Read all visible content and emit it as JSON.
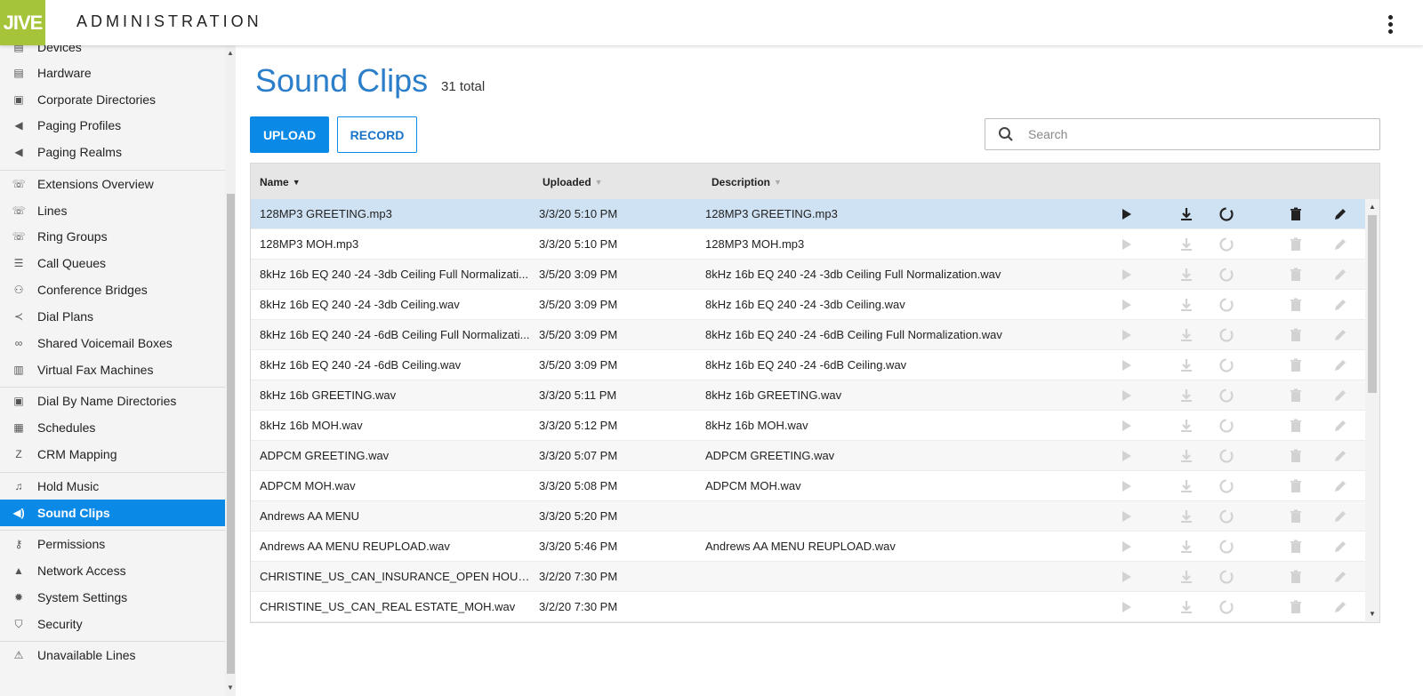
{
  "header": {
    "logo": "JIVE",
    "title": "ADMINISTRATION"
  },
  "sidebar": {
    "items": [
      {
        "label": "Devices",
        "icon": "list-icon"
      },
      {
        "label": "Hardware",
        "icon": "list-icon"
      },
      {
        "label": "Corporate Directories",
        "icon": "contact-book-icon"
      },
      {
        "label": "Paging Profiles",
        "icon": "megaphone-icon"
      },
      {
        "label": "Paging Realms",
        "icon": "megaphone-icon"
      },
      {
        "label": "Extensions Overview",
        "icon": "phone-icon"
      },
      {
        "label": "Lines",
        "icon": "phone-icon"
      },
      {
        "label": "Ring Groups",
        "icon": "ring-group-icon"
      },
      {
        "label": "Call Queues",
        "icon": "queue-icon"
      },
      {
        "label": "Conference Bridges",
        "icon": "conference-icon"
      },
      {
        "label": "Dial Plans",
        "icon": "dial-plan-icon"
      },
      {
        "label": "Shared Voicemail Boxes",
        "icon": "voicemail-icon"
      },
      {
        "label": "Virtual Fax Machines",
        "icon": "fax-icon"
      },
      {
        "label": "Dial By Name Directories",
        "icon": "contact-book-icon"
      },
      {
        "label": "Schedules",
        "icon": "calendar-icon"
      },
      {
        "label": "CRM Mapping",
        "icon": "crm-icon"
      },
      {
        "label": "Hold Music",
        "icon": "music-icon"
      },
      {
        "label": "Sound Clips",
        "icon": "speaker-icon"
      },
      {
        "label": "Permissions",
        "icon": "key-icon"
      },
      {
        "label": "Network Access",
        "icon": "lock-icon"
      },
      {
        "label": "System Settings",
        "icon": "gear-icon"
      },
      {
        "label": "Security",
        "icon": "shield-icon"
      },
      {
        "label": "Unavailable Lines",
        "icon": "warning-icon"
      }
    ],
    "active": "Sound Clips"
  },
  "main": {
    "title": "Sound Clips",
    "total": "31 total",
    "upload_label": "UPLOAD",
    "record_label": "RECORD",
    "search_placeholder": "Search"
  },
  "table": {
    "columns": [
      "Name",
      "Uploaded",
      "Description"
    ],
    "sort_column": "Name",
    "rows": [
      {
        "name": "128MP3 GREETING.mp3",
        "uploaded": "3/3/20 5:10 PM",
        "description": "128MP3 GREETING.mp3"
      },
      {
        "name": "128MP3 MOH.mp3",
        "uploaded": "3/3/20 5:10 PM",
        "description": "128MP3 MOH.mp3"
      },
      {
        "name": "8kHz 16b EQ 240 -24 -3db Ceiling Full Normalizati...",
        "uploaded": "3/5/20 3:09 PM",
        "description": "8kHz 16b EQ 240 -24 -3db Ceiling Full Normalization.wav"
      },
      {
        "name": "8kHz 16b EQ 240 -24 -3db Ceiling.wav",
        "uploaded": "3/5/20 3:09 PM",
        "description": "8kHz 16b EQ 240 -24 -3db Ceiling.wav"
      },
      {
        "name": "8kHz 16b EQ 240 -24 -6dB Ceiling Full Normalizati...",
        "uploaded": "3/5/20 3:09 PM",
        "description": "8kHz 16b EQ 240 -24 -6dB Ceiling Full Normalization.wav"
      },
      {
        "name": "8kHz 16b EQ 240 -24 -6dB Ceiling.wav",
        "uploaded": "3/5/20 3:09 PM",
        "description": "8kHz 16b EQ 240 -24 -6dB Ceiling.wav"
      },
      {
        "name": "8kHz 16b GREETING.wav",
        "uploaded": "3/3/20 5:11 PM",
        "description": "8kHz 16b GREETING.wav"
      },
      {
        "name": "8kHz 16b MOH.wav",
        "uploaded": "3/3/20 5:12 PM",
        "description": "8kHz 16b MOH.wav"
      },
      {
        "name": "ADPCM GREETING.wav",
        "uploaded": "3/3/20 5:07 PM",
        "description": "ADPCM GREETING.wav"
      },
      {
        "name": "ADPCM MOH.wav",
        "uploaded": "3/3/20 5:08 PM",
        "description": "ADPCM MOH.wav"
      },
      {
        "name": "Andrews AA MENU",
        "uploaded": "3/3/20 5:20 PM",
        "description": ""
      },
      {
        "name": "Andrews AA MENU REUPLOAD.wav",
        "uploaded": "3/3/20 5:46 PM",
        "description": "Andrews AA MENU REUPLOAD.wav"
      },
      {
        "name": "CHRISTINE_US_CAN_INSURANCE_OPEN HOUR...",
        "uploaded": "3/2/20 7:30 PM",
        "description": ""
      },
      {
        "name": "CHRISTINE_US_CAN_REAL ESTATE_MOH.wav",
        "uploaded": "3/2/20 7:30 PM",
        "description": ""
      }
    ],
    "selected_row": 0,
    "row_actions": [
      "play-icon",
      "download-icon",
      "replace-icon",
      "delete-icon",
      "edit-icon"
    ]
  },
  "colors": {
    "accent": "#0a8ae6",
    "title": "#2b7ec9",
    "logo": "#a6c43a",
    "selected_row": "#cfe2f3"
  }
}
